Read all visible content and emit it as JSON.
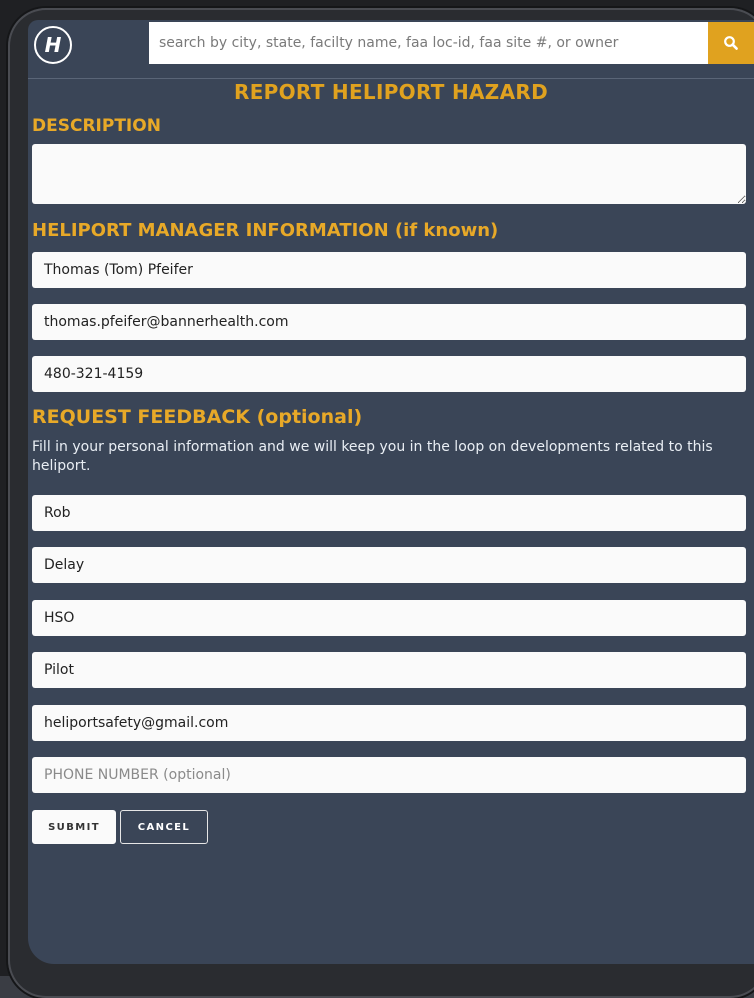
{
  "header": {
    "logo_letter": "H",
    "search_placeholder": "search by city, state, facilty name, faa loc-id, faa site #, or owner",
    "search_icon": "search-icon"
  },
  "page_title": "REPORT HELIPORT HAZARD",
  "description": {
    "label": "DESCRIPTION",
    "value": ""
  },
  "manager": {
    "label": "HELIPORT MANAGER INFORMATION (if known)",
    "name": "Thomas (Tom) Pfeifer",
    "email": "thomas.pfeifer@bannerhealth.com",
    "phone": "480-321-4159"
  },
  "feedback": {
    "label": "REQUEST FEEDBACK (optional)",
    "note": "Fill in your personal information and we will keep you in the loop on developments related to this heliport.",
    "first_name": "Rob",
    "last_name": "Delay",
    "organization": "HSO",
    "role": "Pilot",
    "email": "heliportsafety@gmail.com",
    "phone_placeholder": "PHONE NUMBER (optional)"
  },
  "actions": {
    "submit": "SUBMIT",
    "cancel": "CANCEL"
  },
  "colors": {
    "accent": "#e0a21f",
    "background": "#3a4557"
  }
}
